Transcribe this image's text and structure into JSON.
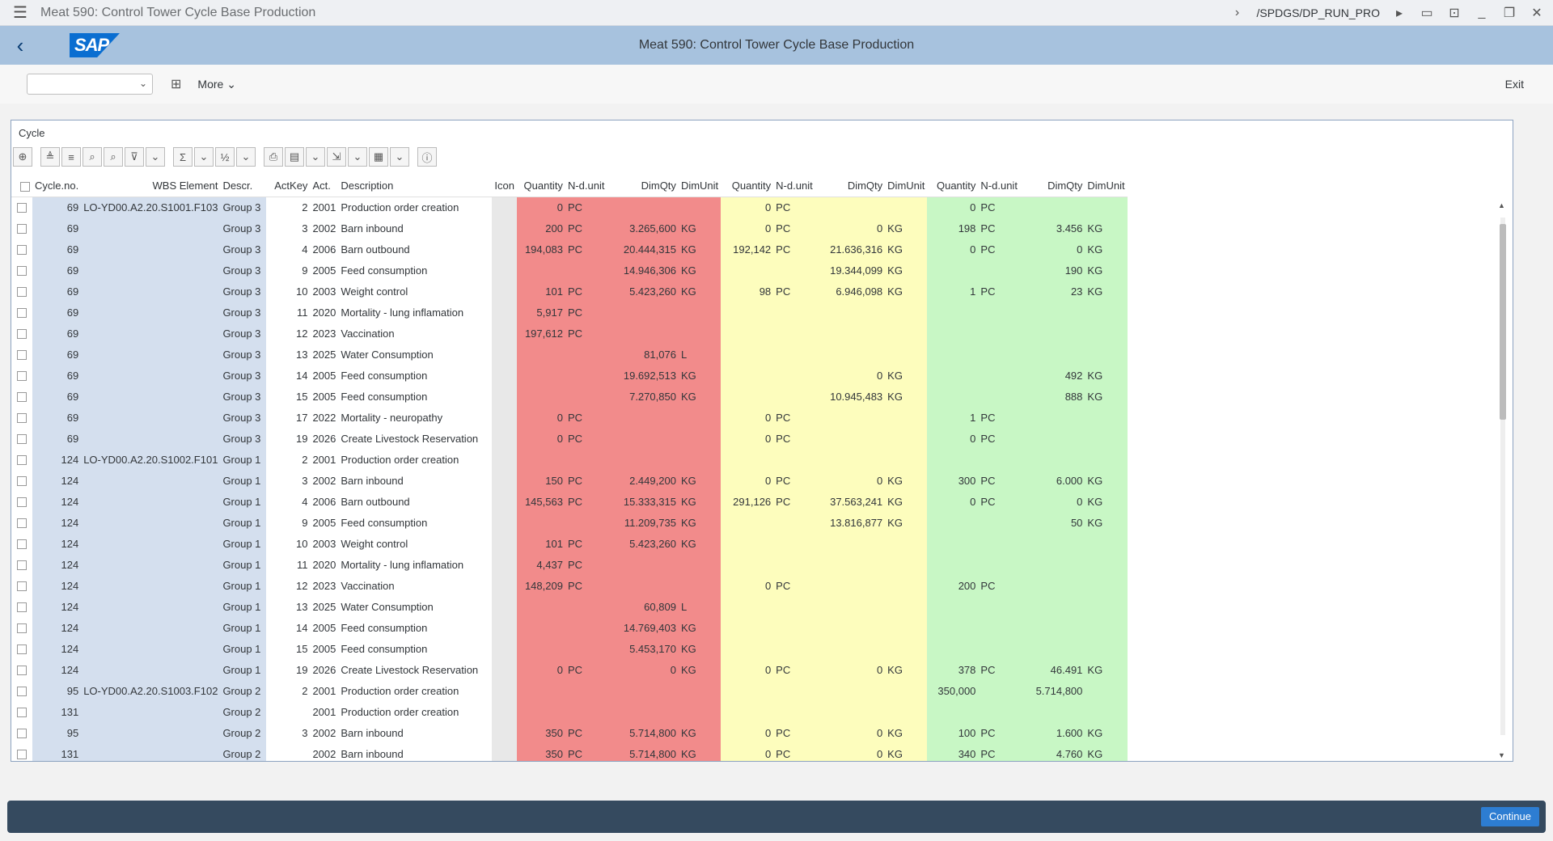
{
  "window": {
    "title": "Meat 590: Control Tower Cycle Base Production",
    "tcode": "/SPDGS/DP_RUN_PRO"
  },
  "shell": {
    "title": "Meat 590: Control Tower Cycle Base Production",
    "logo": "SAP"
  },
  "toolbar": {
    "more_label": "More",
    "exit_label": "Exit"
  },
  "panel": {
    "title": "Cycle"
  },
  "table": {
    "headers": [
      "Cycle.no.",
      "WBS Element",
      "Descr.",
      "ActKey",
      "Act.",
      "Description",
      "Icon",
      "Quantity",
      "N-d.unit",
      "DimQty",
      "DimUnit",
      "Quantity",
      "N-d.unit",
      "DimQty",
      "DimUnit",
      "Quantity",
      "N-d.unit",
      "DimQty",
      "DimUnit"
    ],
    "rows": [
      [
        "69",
        "LO-YD00.A2.20.S1001.F103",
        "Group 3",
        "2",
        "2001",
        "Production order creation",
        "",
        "0",
        "PC",
        "",
        "",
        "0",
        "PC",
        "",
        "",
        "0",
        "PC",
        "",
        ""
      ],
      [
        "69",
        "",
        "Group 3",
        "3",
        "2002",
        "Barn inbound",
        "",
        "200",
        "PC",
        "3.265,600",
        "KG",
        "0",
        "PC",
        "0",
        "KG",
        "198",
        "PC",
        "3.456",
        "KG"
      ],
      [
        "69",
        "",
        "Group 3",
        "4",
        "2006",
        "Barn outbound",
        "",
        "194,083",
        "PC",
        "20.444,315",
        "KG",
        "192,142",
        "PC",
        "21.636,316",
        "KG",
        "0",
        "PC",
        "0",
        "KG"
      ],
      [
        "69",
        "",
        "Group 3",
        "9",
        "2005",
        "Feed consumption",
        "",
        "",
        "",
        "14.946,306",
        "KG",
        "",
        "",
        "19.344,099",
        "KG",
        "",
        "",
        "190",
        "KG"
      ],
      [
        "69",
        "",
        "Group 3",
        "10",
        "2003",
        "Weight control",
        "",
        "101",
        "PC",
        "5.423,260",
        "KG",
        "98",
        "PC",
        "6.946,098",
        "KG",
        "1",
        "PC",
        "23",
        "KG"
      ],
      [
        "69",
        "",
        "Group 3",
        "11",
        "2020",
        "Mortality - lung inflamation",
        "",
        "5,917",
        "PC",
        "",
        "",
        "",
        "",
        "",
        "",
        "",
        "",
        "",
        ""
      ],
      [
        "69",
        "",
        "Group 3",
        "12",
        "2023",
        "Vaccination",
        "",
        "197,612",
        "PC",
        "",
        "",
        "",
        "",
        "",
        "",
        "",
        "",
        "",
        ""
      ],
      [
        "69",
        "",
        "Group 3",
        "13",
        "2025",
        "Water Consumption",
        "",
        "",
        "",
        "81,076",
        "L",
        "",
        "",
        "",
        "",
        "",
        "",
        "",
        ""
      ],
      [
        "69",
        "",
        "Group 3",
        "14",
        "2005",
        "Feed consumption",
        "",
        "",
        "",
        "19.692,513",
        "KG",
        "",
        "",
        "0",
        "KG",
        "",
        "",
        "492",
        "KG"
      ],
      [
        "69",
        "",
        "Group 3",
        "15",
        "2005",
        "Feed consumption",
        "",
        "",
        "",
        "7.270,850",
        "KG",
        "",
        "",
        "10.945,483",
        "KG",
        "",
        "",
        "888",
        "KG"
      ],
      [
        "69",
        "",
        "Group 3",
        "17",
        "2022",
        "Mortality - neuropathy",
        "",
        "0",
        "PC",
        "",
        "",
        "0",
        "PC",
        "",
        "",
        "1",
        "PC",
        "",
        ""
      ],
      [
        "69",
        "",
        "Group 3",
        "19",
        "2026",
        "Create Livestock Reservation",
        "",
        "0",
        "PC",
        "",
        "",
        "0",
        "PC",
        "",
        "",
        "0",
        "PC",
        "",
        ""
      ],
      [
        "124",
        "LO-YD00.A2.20.S1002.F101",
        "Group 1",
        "2",
        "2001",
        "Production order creation",
        "",
        "",
        "",
        "",
        "",
        "",
        "",
        "",
        "",
        "",
        "",
        "",
        ""
      ],
      [
        "124",
        "",
        "Group 1",
        "3",
        "2002",
        "Barn inbound",
        "",
        "150",
        "PC",
        "2.449,200",
        "KG",
        "0",
        "PC",
        "0",
        "KG",
        "300",
        "PC",
        "6.000",
        "KG"
      ],
      [
        "124",
        "",
        "Group 1",
        "4",
        "2006",
        "Barn outbound",
        "",
        "145,563",
        "PC",
        "15.333,315",
        "KG",
        "291,126",
        "PC",
        "37.563,241",
        "KG",
        "0",
        "PC",
        "0",
        "KG"
      ],
      [
        "124",
        "",
        "Group 1",
        "9",
        "2005",
        "Feed consumption",
        "",
        "",
        "",
        "11.209,735",
        "KG",
        "",
        "",
        "13.816,877",
        "KG",
        "",
        "",
        "50",
        "KG"
      ],
      [
        "124",
        "",
        "Group 1",
        "10",
        "2003",
        "Weight control",
        "",
        "101",
        "PC",
        "5.423,260",
        "KG",
        "",
        "",
        "",
        "",
        "",
        "",
        "",
        ""
      ],
      [
        "124",
        "",
        "Group 1",
        "11",
        "2020",
        "Mortality - lung inflamation",
        "",
        "4,437",
        "PC",
        "",
        "",
        "",
        "",
        "",
        "",
        "",
        "",
        "",
        ""
      ],
      [
        "124",
        "",
        "Group 1",
        "12",
        "2023",
        "Vaccination",
        "",
        "148,209",
        "PC",
        "",
        "",
        "0",
        "PC",
        "",
        "",
        "200",
        "PC",
        "",
        ""
      ],
      [
        "124",
        "",
        "Group 1",
        "13",
        "2025",
        "Water Consumption",
        "",
        "",
        "",
        "60,809",
        "L",
        "",
        "",
        "",
        "",
        "",
        "",
        "",
        ""
      ],
      [
        "124",
        "",
        "Group 1",
        "14",
        "2005",
        "Feed consumption",
        "",
        "",
        "",
        "14.769,403",
        "KG",
        "",
        "",
        "",
        "",
        "",
        "",
        "",
        ""
      ],
      [
        "124",
        "",
        "Group 1",
        "15",
        "2005",
        "Feed consumption",
        "",
        "",
        "",
        "5.453,170",
        "KG",
        "",
        "",
        "",
        "",
        "",
        "",
        "",
        ""
      ],
      [
        "124",
        "",
        "Group 1",
        "19",
        "2026",
        "Create Livestock Reservation",
        "",
        "0",
        "PC",
        "0",
        "KG",
        "0",
        "PC",
        "0",
        "KG",
        "378",
        "PC",
        "46.491",
        "KG"
      ],
      [
        "95",
        "LO-YD00.A2.20.S1003.F102",
        "Group 2",
        "2",
        "2001",
        "Production order creation",
        "",
        "",
        "",
        "",
        "",
        "",
        "",
        "",
        "",
        "350,000",
        "",
        "5.714,800",
        ""
      ],
      [
        "131",
        "",
        "Group 2",
        "",
        "2001",
        "Production order creation",
        "",
        "",
        "",
        "",
        "",
        "",
        "",
        "",
        "",
        "",
        "",
        "",
        ""
      ],
      [
        "95",
        "",
        "Group 2",
        "3",
        "2002",
        "Barn inbound",
        "",
        "350",
        "PC",
        "5.714,800",
        "KG",
        "0",
        "PC",
        "0",
        "KG",
        "100",
        "PC",
        "1.600",
        "KG"
      ],
      [
        "131",
        "",
        "Group 2",
        "",
        "2002",
        "Barn inbound",
        "",
        "350",
        "PC",
        "5.714,800",
        "KG",
        "0",
        "PC",
        "0",
        "KG",
        "340",
        "PC",
        "4.760",
        "KG"
      ]
    ]
  },
  "footer": {
    "continue_label": "Continue"
  }
}
